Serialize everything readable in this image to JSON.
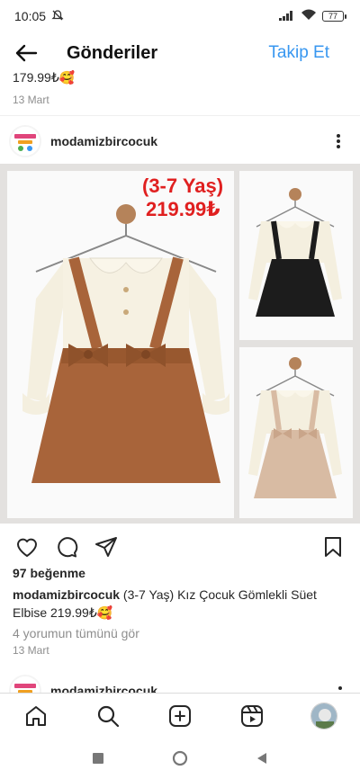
{
  "status_bar": {
    "time": "10:05",
    "battery": "77"
  },
  "header": {
    "title": "Gönderiler",
    "follow_label": "Takip Et"
  },
  "previous_post": {
    "caption_tail": "179.99₺🥰",
    "date": "13 Mart"
  },
  "post": {
    "username": "modamizbircocuk",
    "image_overlay": {
      "age_range": "(3-7 Yaş)",
      "price": "219.99₺"
    },
    "likes": "97 beğenme",
    "caption_username": "modamizbircocuk",
    "caption_text": " (3-7 Yaş) Kız Çocuk Gömlekli Süet Elbise 219.99₺🥰",
    "comments_link": "4 yorumun tümünü gör",
    "date": "13 Mart"
  },
  "next_post": {
    "username": "modamizbircocuk"
  },
  "bottom_nav": {
    "items": [
      {
        "name": "home",
        "icon": "home-icon"
      },
      {
        "name": "search",
        "icon": "search-icon"
      },
      {
        "name": "create",
        "icon": "plus-square-icon"
      },
      {
        "name": "reels",
        "icon": "reels-icon"
      },
      {
        "name": "profile",
        "icon": "avatar"
      }
    ]
  },
  "colors": {
    "accent": "#3897f0",
    "price_red": "#e02020",
    "text": "#262626",
    "muted": "#8e8e8e"
  }
}
